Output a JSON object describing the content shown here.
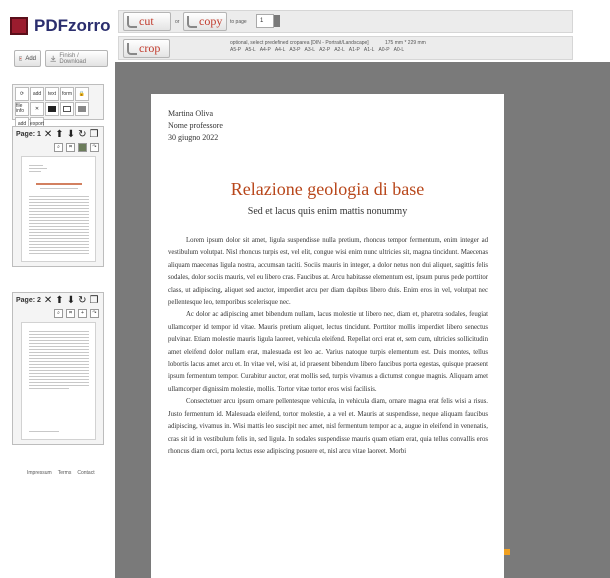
{
  "app": {
    "name": "PDFzorro"
  },
  "sidebar": {
    "add_label": "Add",
    "finish_label": "Finish / Download",
    "tools": [
      {
        "icon": "rotate-icon",
        "label": ""
      },
      {
        "icon": "add-icon",
        "label": "add"
      },
      {
        "icon": "text-icon",
        "label": "text"
      },
      {
        "icon": "form-icon",
        "label": "form"
      },
      {
        "icon": "lock-icon",
        "label": ""
      },
      {
        "icon": "file-info-icon",
        "label": "file info"
      },
      {
        "icon": "scissors-icon",
        "label": ""
      },
      {
        "icon": "black-box-icon",
        "label": ""
      },
      {
        "icon": "white-box-icon",
        "label": ""
      },
      {
        "icon": "eraser-icon",
        "label": ""
      },
      {
        "icon": "add-pdf-icon",
        "label": "add"
      },
      {
        "icon": "export-icon",
        "label": "export"
      }
    ],
    "pages": [
      {
        "label": "Page: 1"
      },
      {
        "label": "Page: 2"
      }
    ],
    "footer": {
      "impressum": "Impressum",
      "terms": "Terms",
      "contact": "Contact"
    }
  },
  "toolbar": {
    "cut_label": "cut",
    "or_label": "or",
    "copy_label": "copy",
    "to_page_label": "to page",
    "to_page_value": "1",
    "crop_label": "crop",
    "crop_hint": "optional, select predefined croparea [DIN - Portrait/Landscape]",
    "crop_size": "175 mm * 229 mm",
    "formats": [
      "A5-P",
      "A5-L",
      "A4-P",
      "A4-L",
      "A3-P",
      "A3-L",
      "A2-P",
      "A2-L",
      "A1-P",
      "A1-L",
      "A0-P",
      "A0-L"
    ]
  },
  "document": {
    "author": "Martina Oliva",
    "role": "Nome professore",
    "date": "30 giugno 2022",
    "title": "Relazione geologia di base",
    "subtitle": "Sed et lacus quis enim mattis nonummy",
    "paragraphs": [
      "Lorem ipsum dolor sit amet, ligula suspendisse nulla pretium, rhoncus tempor fermentum, enim integer ad vestibulum volutpat. Nisl rhoncus turpis est, vel elit, congue wisi enim nunc ultricies sit, magna tincidunt. Maecenas aliquam maecenas ligula nostra, accumsan taciti. Sociis mauris in integer, a dolor netus non dui aliquet, sagittis felis sodales, dolor sociis mauris, vel eu libero cras. Faucibus at. Arcu habitasse elementum est, ipsum purus pede porttitor class, ut adipiscing, aliquet sed auctor, imperdiet arcu per diam dapibus libero duis. Enim eros in vel, volutpat nec pellentesque leo, temporibus scelerisque nec.",
      "Ac dolor ac adipiscing amet bibendum nullam, lacus molestie ut libero nec, diam et, pharetra sodales, feugiat ullamcorper id tempor id vitae. Mauris pretium aliquet, lectus tincidunt. Porttitor mollis imperdiet libero senectus pulvinar. Etiam molestie mauris ligula laoreet, vehicula eleifend. Repellat orci erat et, sem cum, ultricies sollicitudin amet eleifend dolor nullam erat, malesuada est leo ac. Varius natoque turpis elementum est. Duis montes, tellus lobortis lacus amet arcu et. In vitae vel, wisi at, id praesent bibendum libero faucibus porta egestas, quisque praesent ipsum fermentum tempor. Curabitur auctor, erat mollis sed, turpis vivamus a dictumst congue magnis. Aliquam amet ullamcorper dignissim molestie, mollis. Tortor vitae tortor eros wisi facilisis.",
      "Consectetuer arcu ipsum ornare pellentesque vehicula, in vehicula diam, ornare magna erat felis wisi a risus. Justo fermentum id. Malesuada eleifend, tortor molestie, a a vel et. Mauris at suspendisse, neque aliquam faucibus adipiscing, vivamus in. Wisi mattis leo suscipit nec amet, nisl fermentum tempor ac a, augue in eleifend in venenatis, cras sit id in vestibulum felis in, sed ligula. In sodales suspendisse mauris quam etiam erat, quia tellus convallis eros rhoncus diam orci, porta lectus esse adipiscing posuere et, nisl arcu vitae laoreet. Morbi"
    ]
  }
}
